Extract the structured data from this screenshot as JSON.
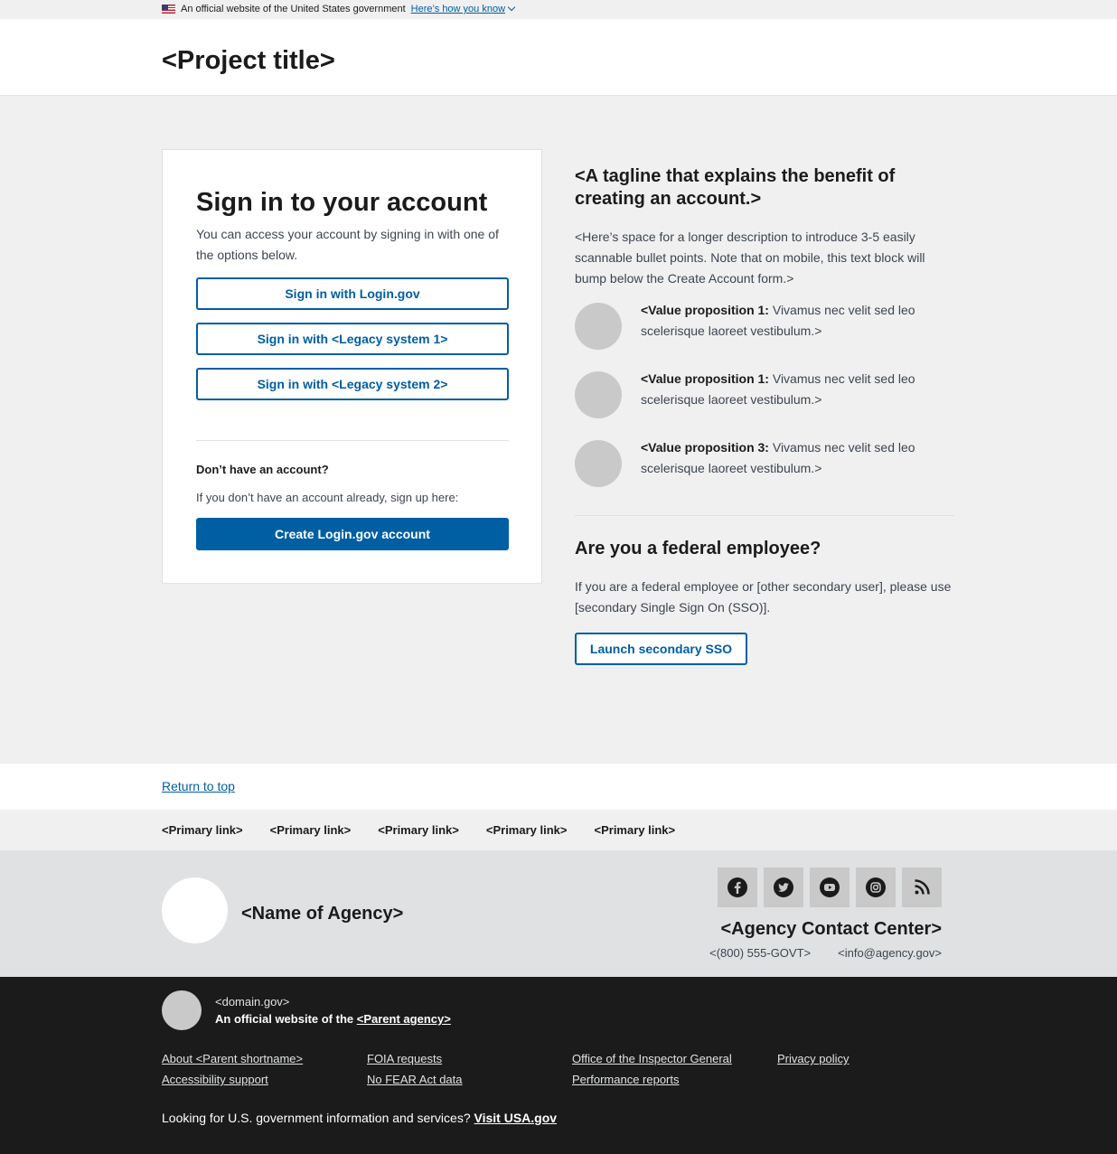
{
  "banner": {
    "text": "An official website of the United States government",
    "link": "Here’s how you know"
  },
  "header": {
    "title": "<Project title>"
  },
  "signin": {
    "title": "Sign in to your account",
    "lede": "You can access your account by signing in with one of the options below.",
    "buttons": [
      "Sign in with Login.gov",
      "Sign in with <Legacy system 1>",
      "Sign in with <Legacy system 2>"
    ],
    "no_account_heading": "Don’t have an account?",
    "no_account_text": "If you don’t have an account already, sign up here:",
    "create_button": "Create Login.gov account"
  },
  "side": {
    "tagline": "<A tagline that explains the benefit of creating an account.>",
    "description": "<Here’s space for a longer description to introduce 3-5 easily scannable bullet points. Note that on mobile, this text block will bump below the Create Account form.>",
    "value_props": [
      {
        "label": "<Value proposition 1:",
        "text": " Vivamus nec velit sed leo scelerisque laoreet vestibulum.>"
      },
      {
        "label": "<Value proposition 1:",
        "text": " Vivamus nec velit sed leo scelerisque laoreet vestibulum.>"
      },
      {
        "label": "<Value proposition 3:",
        "text": " Vivamus nec velit sed leo scelerisque laoreet vestibulum.>"
      }
    ],
    "fed_title": "Are you a federal employee?",
    "fed_text": "If you are a federal employee or [other secondary user], please use [secondary Single Sign On (SSO)].",
    "sso_button": "Launch secondary SSO"
  },
  "footer": {
    "return_to_top": "Return to top",
    "primary_links": [
      "<Primary link>",
      "<Primary link>",
      "<Primary link>",
      "<Primary link>",
      "<Primary link>"
    ],
    "agency_name": "<Name of Agency>",
    "social_icons": [
      "facebook-icon",
      "twitter-icon",
      "youtube-icon",
      "instagram-icon",
      "rss-icon"
    ],
    "contact_heading": "<Agency Contact Center>",
    "phone": "<(800) 555-GOVT>",
    "email": "<info@agency.gov>"
  },
  "identifier": {
    "domain": "<domain.gov>",
    "official_prefix": "An official website of the ",
    "parent_agency": "<Parent agency>",
    "links": [
      "About <Parent shortname>",
      "FOIA requests",
      "Office of the Inspector General",
      "Privacy policy",
      "Accessibility support",
      "No FEAR Act data",
      "Performance reports"
    ],
    "usa_prefix": "Looking for U.S. government information and services? ",
    "usa_link": "Visit USA.gov"
  }
}
